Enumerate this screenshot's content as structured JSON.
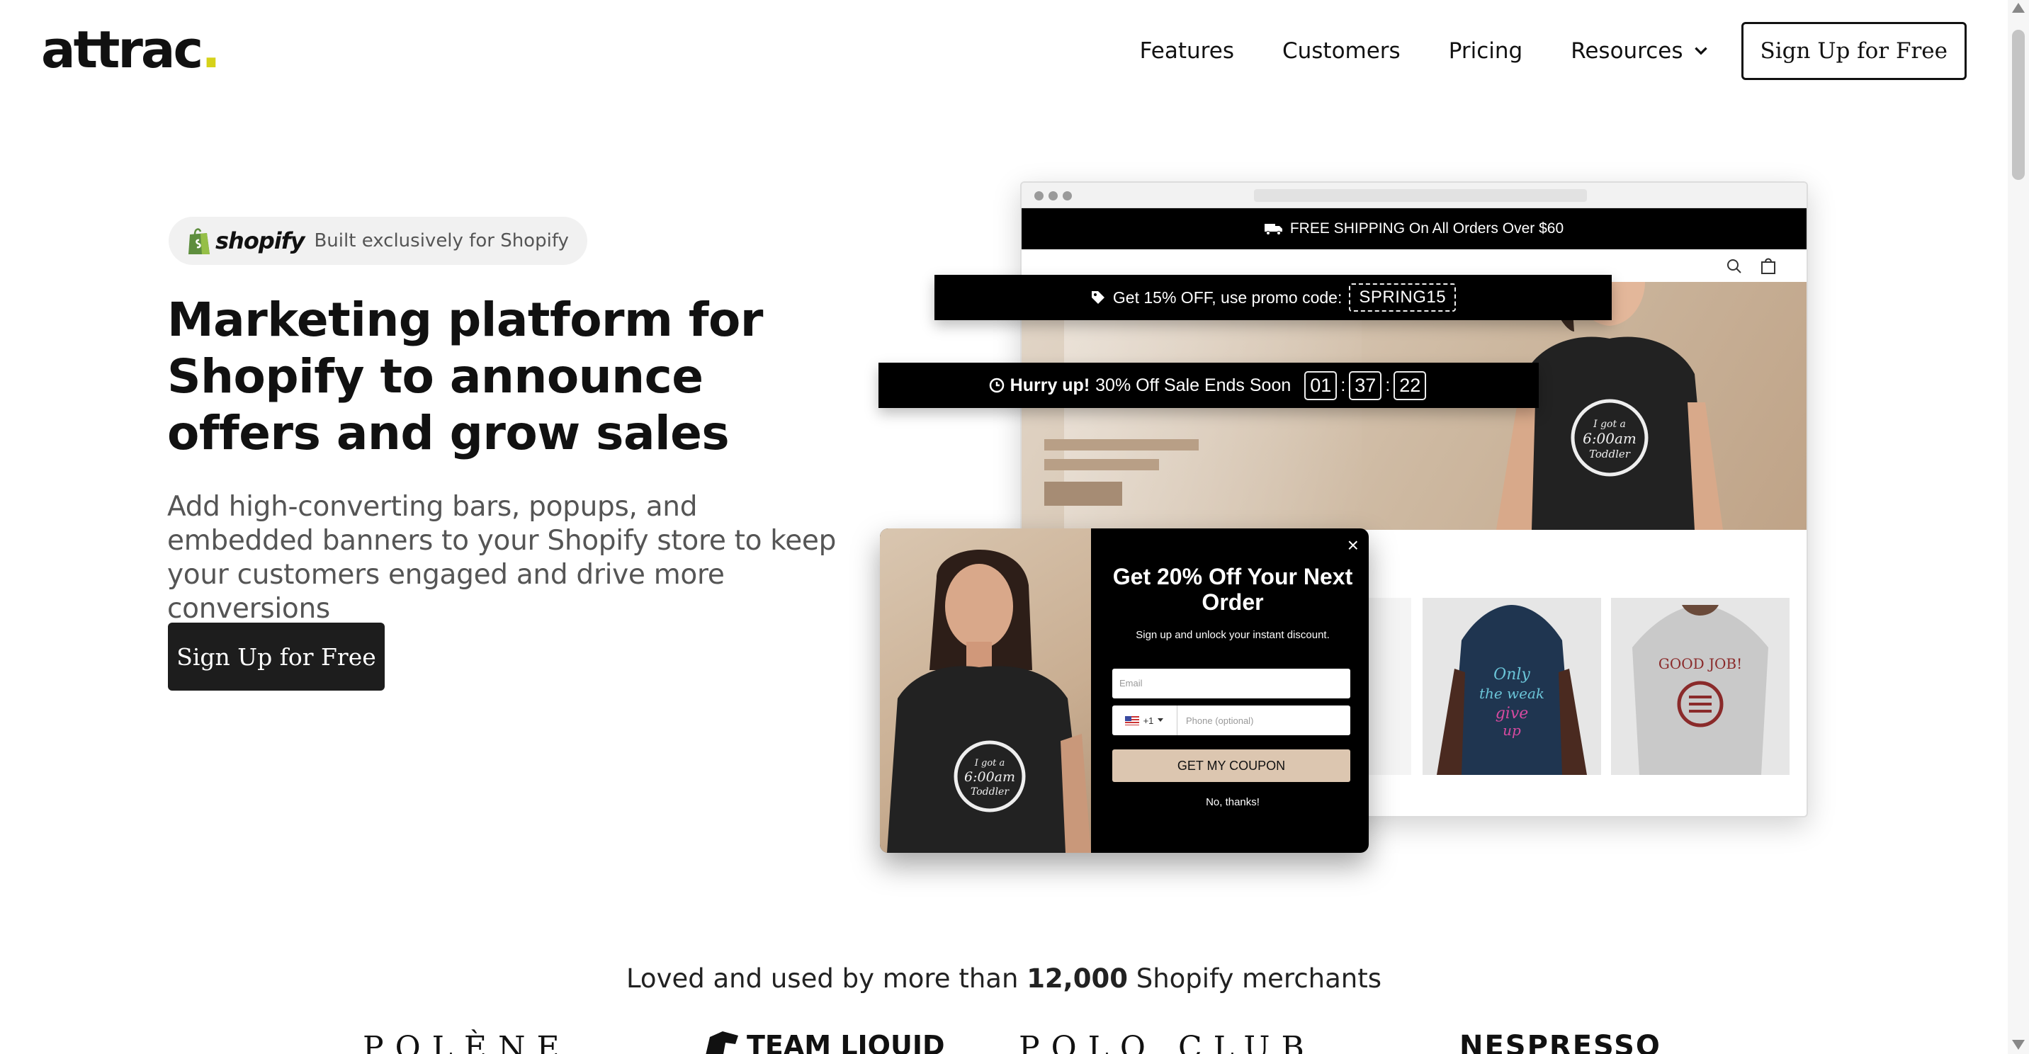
{
  "brand": {
    "logo_text": "attrac",
    "logo_dot": ".",
    "accent_color": "#d6d21a"
  },
  "nav": {
    "items": [
      {
        "label": "Features"
      },
      {
        "label": "Customers"
      },
      {
        "label": "Pricing"
      },
      {
        "label": "Resources"
      }
    ],
    "signup_label": "Sign Up for Free"
  },
  "hero": {
    "badge_brand": "shopify",
    "badge_text": "Built exclusively for Shopify",
    "headline": "Marketing platform for Shopify to announce offers and grow sales",
    "subhead": "Add high-converting bars, popups, and embedded banners to your Shopify store to keep your customers engaged and drive more conversions",
    "cta_label": "Sign Up for Free"
  },
  "mockup": {
    "shipping_bar": "FREE SHIPPING On All Orders Over $60",
    "promo_bar": {
      "text": "Get 15% OFF, use promo code:",
      "code": "SPRING15"
    },
    "timer_bar": {
      "bold": "Hurry up!",
      "text": "30% Off Sale Ends Soon",
      "hours": "01",
      "minutes": "37",
      "seconds": "22"
    },
    "tee_print": {
      "line1": "I got a",
      "line2": "6:00am",
      "line3": "Toddler"
    },
    "product_prints": {
      "navy": [
        "Only",
        "the weak",
        "give",
        "up"
      ],
      "grey": "GOOD JOB!"
    },
    "popup": {
      "title": "Get 20% Off Your Next Order",
      "subtitle": "Sign up and unlock your instant discount.",
      "email_placeholder": "Email",
      "country_code": "+1",
      "phone_placeholder": "Phone (optional)",
      "button_label": "GET MY COUPON",
      "decline_label": "No, thanks!",
      "close_glyph": "×"
    }
  },
  "social_proof": {
    "prefix": "Loved and used by more than",
    "count": "12,000",
    "suffix": "Shopify merchants",
    "brands": [
      "POLÈNE",
      "TEAM LIQUID",
      "POLO CLUB",
      "NESPRESSO"
    ]
  }
}
